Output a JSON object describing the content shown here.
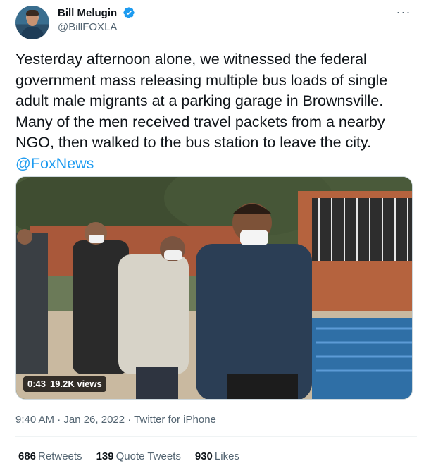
{
  "author": {
    "display_name": "Bill Melugin",
    "handle": "@BillFOXLA",
    "avatar_icon": "profile-photo",
    "verified_icon": "verified-badge-icon",
    "verified_color": "#1d9bf0"
  },
  "tweet": {
    "text": "Yesterday afternoon alone, we witnessed the federal government mass releasing multiple bus loads of single adult male migrants at a parking garage in Brownsville. Many of the men received travel packets from a nearby NGO, then walked to the bus station to leave the city.",
    "mention": "@FoxNews",
    "link_color": "#1d9bf0"
  },
  "media": {
    "duration": "0:43",
    "views": "19.2K views"
  },
  "meta": {
    "timestamp": "9:40 AM · Jan 26, 2022 · Twitter for iPhone"
  },
  "stats": {
    "retweets_count": "686",
    "retweets_label": "Retweets",
    "quotes_count": "139",
    "quotes_label": "Quote Tweets",
    "likes_count": "930",
    "likes_label": "Likes"
  }
}
